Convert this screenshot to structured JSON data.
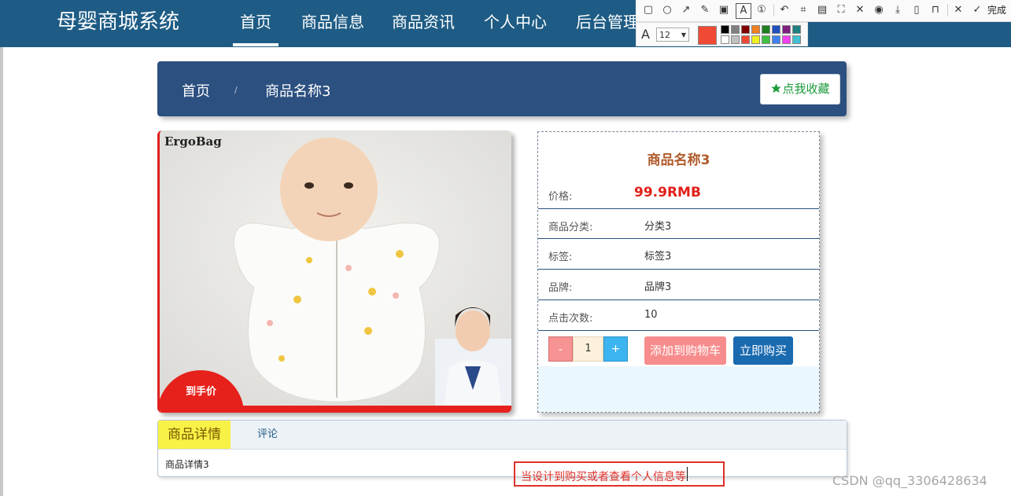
{
  "app": {
    "brand": "母婴商城系统"
  },
  "nav": [
    {
      "label": "首页",
      "active": true
    },
    {
      "label": "商品信息"
    },
    {
      "label": "商品资讯"
    },
    {
      "label": "个人中心"
    },
    {
      "label": "后台管理"
    }
  ],
  "breadcrumb": {
    "home": "首页",
    "separator": "/",
    "current": "商品名称3"
  },
  "favorite": {
    "label": "点我收藏",
    "icon": "star-icon"
  },
  "product": {
    "image_brand": "ErgoBag",
    "image_badge": "到手价",
    "name": "商品名称3",
    "price_label": "价格:",
    "price_value": "99.9RMB",
    "rows": [
      {
        "label": "商品分类:",
        "value": "分类3"
      },
      {
        "label": "标签:",
        "value": "标签3"
      },
      {
        "label": "品牌:",
        "value": "品牌3"
      },
      {
        "label": "点击次数:",
        "value": "10"
      }
    ],
    "qty_minus": "-",
    "qty_value": "1",
    "qty_plus": "+",
    "add_cart": "添加到购物车",
    "buy_now": "立即购买"
  },
  "tabs": [
    {
      "label": "商品详情",
      "active": true
    },
    {
      "label": "评论"
    }
  ],
  "detail_content": "商品详情3",
  "annotation": {
    "text": "当设计到购买或者查看个人信息等"
  },
  "watermark": "CSDN @qq_3306428634",
  "screenshot_tool": {
    "done_label": "完成",
    "font_size": "12",
    "current_color": "#f04a35",
    "palette": [
      "#000000",
      "#808080",
      "#800000",
      "#f08020",
      "#208020",
      "#2050c0",
      "#802080",
      "#208080",
      "#ffffff",
      "#c0c0c0",
      "#f04a35",
      "#f0f020",
      "#40c040",
      "#4080f0",
      "#f040f0",
      "#40c0d0"
    ]
  },
  "colors": {
    "navbar": "#1e5c85",
    "breadcrumb": "#2c5080",
    "price": "#e0201a",
    "accent_green": "#1a9a3a"
  }
}
